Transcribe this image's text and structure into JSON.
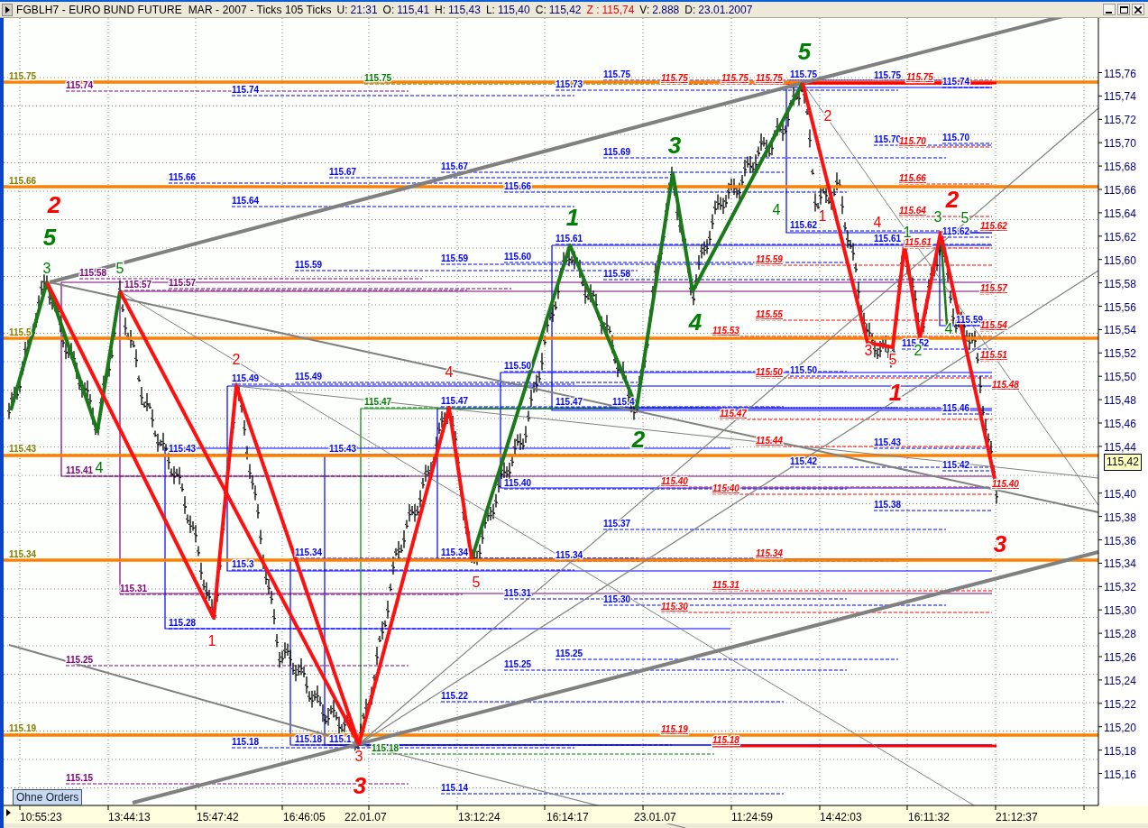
{
  "title_bar": {
    "instrument": "FGBLH7 - EURO BUND FUTURE  MAR - 2007 - Ticks 105 Ticks",
    "fields": [
      {
        "label": "U:",
        "value": "21:31",
        "color": "#000080"
      },
      {
        "label": "O:",
        "value": "115,41",
        "color": "#000080"
      },
      {
        "label": "H:",
        "value": "115,43",
        "color": "#000080"
      },
      {
        "label": "L:",
        "value": "115,40",
        "color": "#000080"
      },
      {
        "label": "C:",
        "value": "115,42",
        "color": "#000080"
      },
      {
        "label": "Z :",
        "value": "115,74",
        "color": "#ff0000"
      },
      {
        "label": "V:",
        "value": "2.888",
        "color": "#000080"
      },
      {
        "label": "D:",
        "value": "23.01.2007",
        "color": "#000080"
      }
    ]
  },
  "chart": {
    "levels": [
      {
        "text": "115.75",
        "kind": "level",
        "color": "#808000"
      },
      {
        "text": "115.74",
        "kind": "level",
        "color": "#800080"
      },
      {
        "text": "115.74",
        "kind": "level",
        "color": "#0000ff"
      },
      {
        "text": "115.75",
        "kind": "level",
        "color": "#008000"
      },
      {
        "text": "115.75",
        "kind": "level",
        "color": "#0000ff"
      },
      {
        "text": "115.73",
        "kind": "level",
        "color": "#0000ff"
      },
      {
        "text": "115.75",
        "kind": "projection",
        "color": "#ff0000"
      },
      {
        "text": "115.75",
        "kind": "projection",
        "color": "#ff0000"
      },
      {
        "text": "115.75",
        "kind": "projection",
        "color": "#ff0000"
      },
      {
        "text": "115.75",
        "kind": "level",
        "color": "#0000ff"
      },
      {
        "text": "115.75",
        "kind": "level",
        "color": "#0000ff"
      },
      {
        "text": "115.75",
        "kind": "projection",
        "color": "#ff0000"
      },
      {
        "text": "115.74",
        "kind": "level",
        "color": "#0000ff"
      },
      {
        "text": "115.69",
        "kind": "level",
        "color": "#0000ff"
      },
      {
        "text": "115.70",
        "kind": "level",
        "color": "#0000ff"
      },
      {
        "text": "115.70",
        "kind": "projection",
        "color": "#ff0000"
      },
      {
        "text": "115.70",
        "kind": "level",
        "color": "#0000ff"
      },
      {
        "text": "115.67",
        "kind": "level",
        "color": "#0000ff"
      },
      {
        "text": "115.67",
        "kind": "level",
        "color": "#0000ff"
      },
      {
        "text": "115.66",
        "kind": "level",
        "color": "#808000"
      },
      {
        "text": "115.66",
        "kind": "level",
        "color": "#0000ff"
      },
      {
        "text": "115.66",
        "kind": "level",
        "color": "#0000ff"
      },
      {
        "text": "115.66",
        "kind": "projection",
        "color": "#ff0000"
      },
      {
        "text": "115.64",
        "kind": "level",
        "color": "#0000ff"
      },
      {
        "text": "115.64",
        "kind": "projection",
        "color": "#ff0000"
      },
      {
        "text": "115.62",
        "kind": "level",
        "color": "#0000ff"
      },
      {
        "text": "115.62",
        "kind": "level",
        "color": "#0000ff"
      },
      {
        "text": "115.62",
        "kind": "projection",
        "color": "#ff0000"
      },
      {
        "text": "115.61",
        "kind": "level",
        "color": "#0000ff"
      },
      {
        "text": "115.61",
        "kind": "level",
        "color": "#0000ff"
      },
      {
        "text": "115.61",
        "kind": "projection",
        "color": "#ff0000"
      },
      {
        "text": "115.58",
        "kind": "level",
        "color": "#800080"
      },
      {
        "text": "115.57",
        "kind": "level",
        "color": "#800080"
      },
      {
        "text": "115.57",
        "kind": "level",
        "color": "#800080"
      },
      {
        "text": "115.59",
        "kind": "level",
        "color": "#0000ff"
      },
      {
        "text": "115.59",
        "kind": "level",
        "color": "#0000ff"
      },
      {
        "text": "115.60",
        "kind": "level",
        "color": "#0000ff"
      },
      {
        "text": "115.58",
        "kind": "level",
        "color": "#0000ff"
      },
      {
        "text": "115.59",
        "kind": "projection",
        "color": "#ff0000"
      },
      {
        "text": "115.59",
        "kind": "level",
        "color": "#0000ff"
      },
      {
        "text": "115.57",
        "kind": "projection",
        "color": "#ff0000"
      },
      {
        "text": "115.55",
        "kind": "projection",
        "color": "#ff0000"
      },
      {
        "text": "115.53",
        "kind": "projection",
        "color": "#ff0000"
      },
      {
        "text": "115.5",
        "kind": "level",
        "color": "#808000"
      },
      {
        "text": "115.54",
        "kind": "projection",
        "color": "#ff0000"
      },
      {
        "text": "115.52",
        "kind": "level",
        "color": "#0000ff"
      },
      {
        "text": "115.51",
        "kind": "projection",
        "color": "#ff0000"
      },
      {
        "text": "115.50",
        "kind": "level",
        "color": "#0000ff"
      },
      {
        "text": "115.50",
        "kind": "projection",
        "color": "#ff0000"
      },
      {
        "text": "115.50",
        "kind": "level",
        "color": "#0000ff"
      },
      {
        "text": "115.49",
        "kind": "level",
        "color": "#0000ff"
      },
      {
        "text": "115.49",
        "kind": "level",
        "color": "#0000ff"
      },
      {
        "text": "115.48",
        "kind": "projection",
        "color": "#ff0000"
      },
      {
        "text": "115.47",
        "kind": "level",
        "color": "#008000"
      },
      {
        "text": "115.47",
        "kind": "level",
        "color": "#0000ff"
      },
      {
        "text": "115.47",
        "kind": "level",
        "color": "#0000ff"
      },
      {
        "text": "115.4",
        "kind": "level",
        "color": "#0000ff"
      },
      {
        "text": "115.47",
        "kind": "projection",
        "color": "#ff0000"
      },
      {
        "text": "115.46",
        "kind": "level",
        "color": "#0000ff"
      },
      {
        "text": "115.44",
        "kind": "projection",
        "color": "#ff0000"
      },
      {
        "text": "115.43",
        "kind": "level",
        "color": "#808000"
      },
      {
        "text": "115.43",
        "kind": "level",
        "color": "#0000ff"
      },
      {
        "text": "115.43",
        "kind": "level",
        "color": "#0000ff"
      },
      {
        "text": "115.43",
        "kind": "level",
        "color": "#0000ff"
      },
      {
        "text": "115.42",
        "kind": "level",
        "color": "#0000ff"
      },
      {
        "text": "115.42",
        "kind": "level",
        "color": "#0000ff"
      },
      {
        "text": "115.41",
        "kind": "level",
        "color": "#800080"
      },
      {
        "text": "115.40",
        "kind": "level",
        "color": "#0000ff"
      },
      {
        "text": "115.40",
        "kind": "projection",
        "color": "#ff0000"
      },
      {
        "text": "115.40",
        "kind": "projection",
        "color": "#ff0000"
      },
      {
        "text": "115.40",
        "kind": "projection",
        "color": "#ff0000"
      },
      {
        "text": "115.38",
        "kind": "level",
        "color": "#0000ff"
      },
      {
        "text": "115.37",
        "kind": "level",
        "color": "#0000ff"
      },
      {
        "text": "115.34",
        "kind": "level",
        "color": "#808000"
      },
      {
        "text": "115.34",
        "kind": "level",
        "color": "#0000ff"
      },
      {
        "text": "115.34",
        "kind": "level",
        "color": "#0000ff"
      },
      {
        "text": "115.34",
        "kind": "level",
        "color": "#0000ff"
      },
      {
        "text": "115.34",
        "kind": "projection",
        "color": "#ff0000"
      },
      {
        "text": "115.3",
        "kind": "level",
        "color": "#0000ff"
      },
      {
        "text": "115.31",
        "kind": "projection",
        "color": "#ff0000"
      },
      {
        "text": "115.31",
        "kind": "level",
        "color": "#800080"
      },
      {
        "text": "115.31",
        "kind": "level",
        "color": "#0000ff"
      },
      {
        "text": "115.30",
        "kind": "level",
        "color": "#0000ff"
      },
      {
        "text": "115.30",
        "kind": "projection",
        "color": "#ff0000"
      },
      {
        "text": "115.28",
        "kind": "level",
        "color": "#0000ff"
      },
      {
        "text": "115.25",
        "kind": "level",
        "color": "#0000ff"
      },
      {
        "text": "115.25",
        "kind": "level",
        "color": "#800080"
      },
      {
        "text": "115.25",
        "kind": "level",
        "color": "#0000ff"
      },
      {
        "text": "115.22",
        "kind": "level",
        "color": "#0000ff"
      },
      {
        "text": "115.19",
        "kind": "level",
        "color": "#808000"
      },
      {
        "text": "115.19",
        "kind": "projection",
        "color": "#ff0000"
      },
      {
        "text": "115.18",
        "kind": "level",
        "color": "#0000ff"
      },
      {
        "text": "115.18",
        "kind": "level",
        "color": "#0000ff"
      },
      {
        "text": "115.1",
        "kind": "level",
        "color": "#0000ff"
      },
      {
        "text": "115.18",
        "kind": "level",
        "color": "#008000"
      },
      {
        "text": "115.18",
        "kind": "projection",
        "color": "#ff0000"
      },
      {
        "text": "115.15",
        "kind": "level",
        "color": "#800080"
      },
      {
        "text": "115.14",
        "kind": "level",
        "color": "#0000ff"
      }
    ],
    "waves": [
      {
        "text": "2",
        "kind": "major",
        "color": "#ff0000"
      },
      {
        "text": "5",
        "kind": "major",
        "color": "#008000"
      },
      {
        "text": "3",
        "kind": "minor",
        "color": "#008000"
      },
      {
        "text": "5",
        "kind": "minor",
        "color": "#008000"
      },
      {
        "text": "4",
        "kind": "minor",
        "color": "#008000"
      },
      {
        "text": "2",
        "kind": "minor",
        "color": "#ff0000"
      },
      {
        "text": "1",
        "kind": "minor",
        "color": "#ff0000"
      },
      {
        "text": "3",
        "kind": "minor",
        "color": "#ff0000"
      },
      {
        "text": "3",
        "kind": "major",
        "color": "#ff0000"
      },
      {
        "text": "4",
        "kind": "minor",
        "color": "#ff0000"
      },
      {
        "text": "5",
        "kind": "minor",
        "color": "#ff0000"
      },
      {
        "text": "1",
        "kind": "major",
        "color": "#008000"
      },
      {
        "text": "3",
        "kind": "major",
        "color": "#008000"
      },
      {
        "text": "4",
        "kind": "major",
        "color": "#008000"
      },
      {
        "text": "2",
        "kind": "major",
        "color": "#008000"
      },
      {
        "text": "5",
        "kind": "major",
        "color": "#008000"
      },
      {
        "text": "4",
        "kind": "minor",
        "color": "#008000"
      },
      {
        "text": "2",
        "kind": "minor",
        "color": "#ff0000"
      },
      {
        "text": "1",
        "kind": "minor",
        "color": "#ff0000"
      },
      {
        "text": "4",
        "kind": "minor",
        "color": "#ff0000"
      },
      {
        "text": "2",
        "kind": "major",
        "color": "#ff0000"
      },
      {
        "text": "3",
        "kind": "minor",
        "color": "#008000"
      },
      {
        "text": "5",
        "kind": "minor",
        "color": "#008000"
      },
      {
        "text": "1",
        "kind": "minor",
        "color": "#008000"
      },
      {
        "text": "3",
        "kind": "minor",
        "color": "#ff0000"
      },
      {
        "text": "5",
        "kind": "minor",
        "color": "#ff0000"
      },
      {
        "text": "2",
        "kind": "minor",
        "color": "#008000"
      },
      {
        "text": "1",
        "kind": "major",
        "color": "#ff0000"
      },
      {
        "text": "3",
        "kind": "major",
        "color": "#ff0000"
      },
      {
        "text": "4",
        "kind": "minor",
        "color": "#008000"
      }
    ],
    "orders_button": "Ohne Orders"
  },
  "price_axis": {
    "ticks": [
      "115,76",
      "115,74",
      "115,72",
      "115,70",
      "115,68",
      "115,66",
      "115,64",
      "115,62",
      "115,60",
      "115,58",
      "115,56",
      "115,54",
      "115,52",
      "115,50",
      "115,48",
      "115,46",
      "115,44",
      "115,40",
      "115,38",
      "115,36",
      "115,34",
      "115,32",
      "115,30",
      "115,28",
      "115,26",
      "115,24",
      "115,22",
      "115,20",
      "115,18",
      "115,16"
    ],
    "current_price": "115,42"
  },
  "time_axis": {
    "labels": [
      "10:55:23",
      "13:44:13",
      "15:47:42",
      "16:46:05",
      "22.01.07",
      "13:12:24",
      "16:14:17",
      "23.01.07",
      "11:24:59",
      "14:42:03",
      "16:11:32",
      "21:12:37"
    ]
  }
}
